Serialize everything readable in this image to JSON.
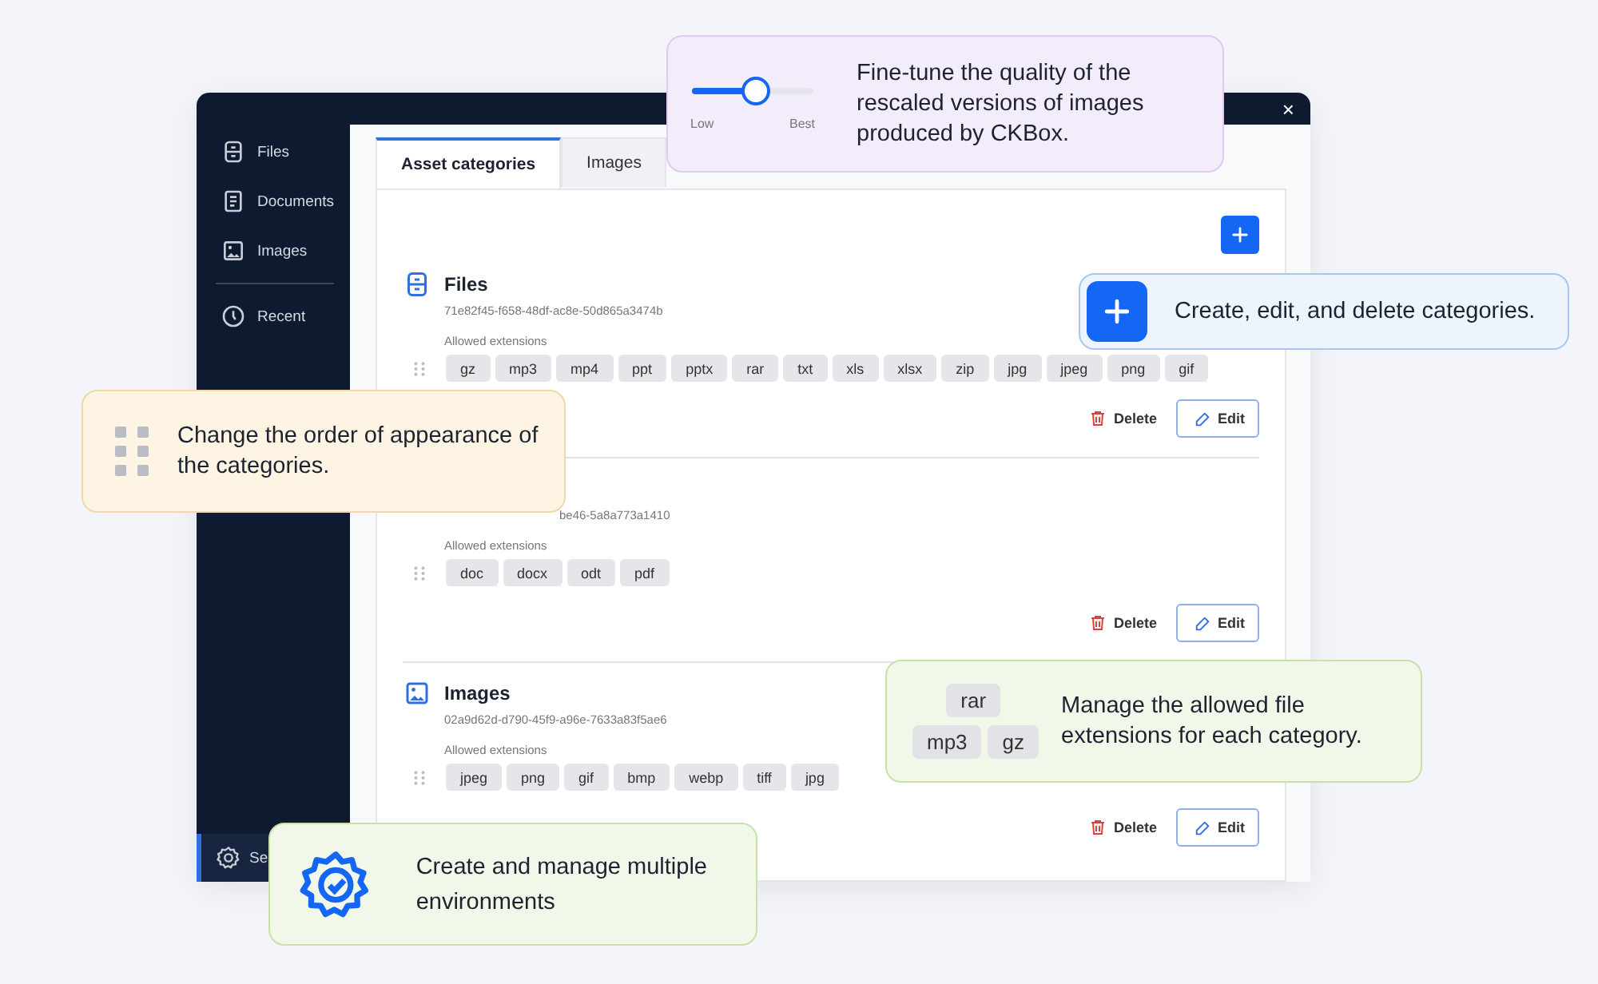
{
  "window": {
    "close": "×"
  },
  "sidebar": {
    "items": [
      {
        "kind": "files",
        "label": "Files",
        "selected": false
      },
      {
        "kind": "documents",
        "label": "Documents",
        "selected": false
      },
      {
        "kind": "images",
        "label": "Images",
        "selected": false
      }
    ],
    "secondary_items": [
      {
        "kind": "recent",
        "label": "Recent",
        "selected": false
      }
    ],
    "footer_item": {
      "kind": "settings",
      "label": "Se",
      "selected": true
    }
  },
  "tabs": [
    {
      "label": "Asset categories",
      "selected": true
    },
    {
      "label": "Images",
      "selected": false
    }
  ],
  "categories": [
    {
      "kind": "files",
      "title": "Files",
      "id": "71e82f45-f658-48df-ac8e-50d865a3474b",
      "extensions_label": "Allowed extensions",
      "extensions": [
        "gz",
        "mp3",
        "mp4",
        "ppt",
        "pptx",
        "rar",
        "txt",
        "xls",
        "xlsx",
        "zip",
        "jpg",
        "jpeg",
        "png",
        "gif"
      ],
      "delete": "Delete",
      "edit": "Edit"
    },
    {
      "id": "be46-5a8a773a1410",
      "extensions_label": "Allowed extensions",
      "extensions": [
        "doc",
        "docx",
        "odt",
        "pdf"
      ],
      "delete": "Delete",
      "edit": "Edit"
    },
    {
      "kind": "images",
      "title": "Images",
      "id": "02a9d62d-d790-45f9-a96e-7633a83f5ae6",
      "extensions_label": "Allowed extensions",
      "extensions": [
        "jpeg",
        "png",
        "gif",
        "bmp",
        "webp",
        "tiff",
        "jpg"
      ],
      "delete": "Delete",
      "edit": "Edit"
    }
  ],
  "callouts": [
    {
      "kind": "slider",
      "color": "#f2ecfb",
      "text": "Fine-tune the quality of the rescaled versions of images produced by CKBox.",
      "slider": {
        "level": 0.52,
        "min_label": "Low",
        "max_label": "Best"
      }
    },
    {
      "kind": "add",
      "color": "#eef4fc",
      "text": "Create, edit, and delete categories."
    },
    {
      "kind": "reorder",
      "color": "#fdf4e3",
      "text": "Change the order of appearance of the categories."
    },
    {
      "kind": "extensions",
      "color": "#f1f8ea",
      "text": "Manage the allowed file extensions for each category.",
      "tags": [
        "rar",
        "mp3",
        "gz"
      ]
    },
    {
      "kind": "environments",
      "color": "#f1f8ea",
      "text": "Create and manage multiple environments"
    }
  ]
}
